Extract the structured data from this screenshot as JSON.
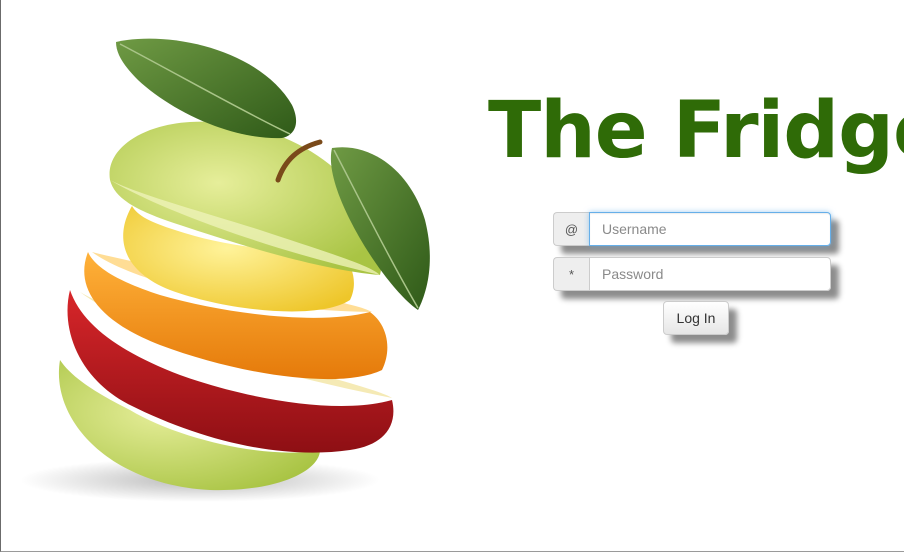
{
  "app": {
    "title": "The Fridge"
  },
  "login": {
    "username_addon": "@",
    "username_placeholder": "Username",
    "username_value": "",
    "password_addon": "*",
    "password_placeholder": "Password",
    "password_value": "",
    "submit_label": "Log In"
  },
  "colors": {
    "title": "#2f6b07",
    "focus_ring": "#66afe9",
    "apple_green": "#c9dc6a",
    "lemon_yellow": "#f3d843",
    "orange": "#f08c14",
    "apple_red": "#b8161e",
    "leaf_green": "#4d7d2e"
  },
  "hero_image": {
    "icon": "fruit-stack-illustration"
  }
}
